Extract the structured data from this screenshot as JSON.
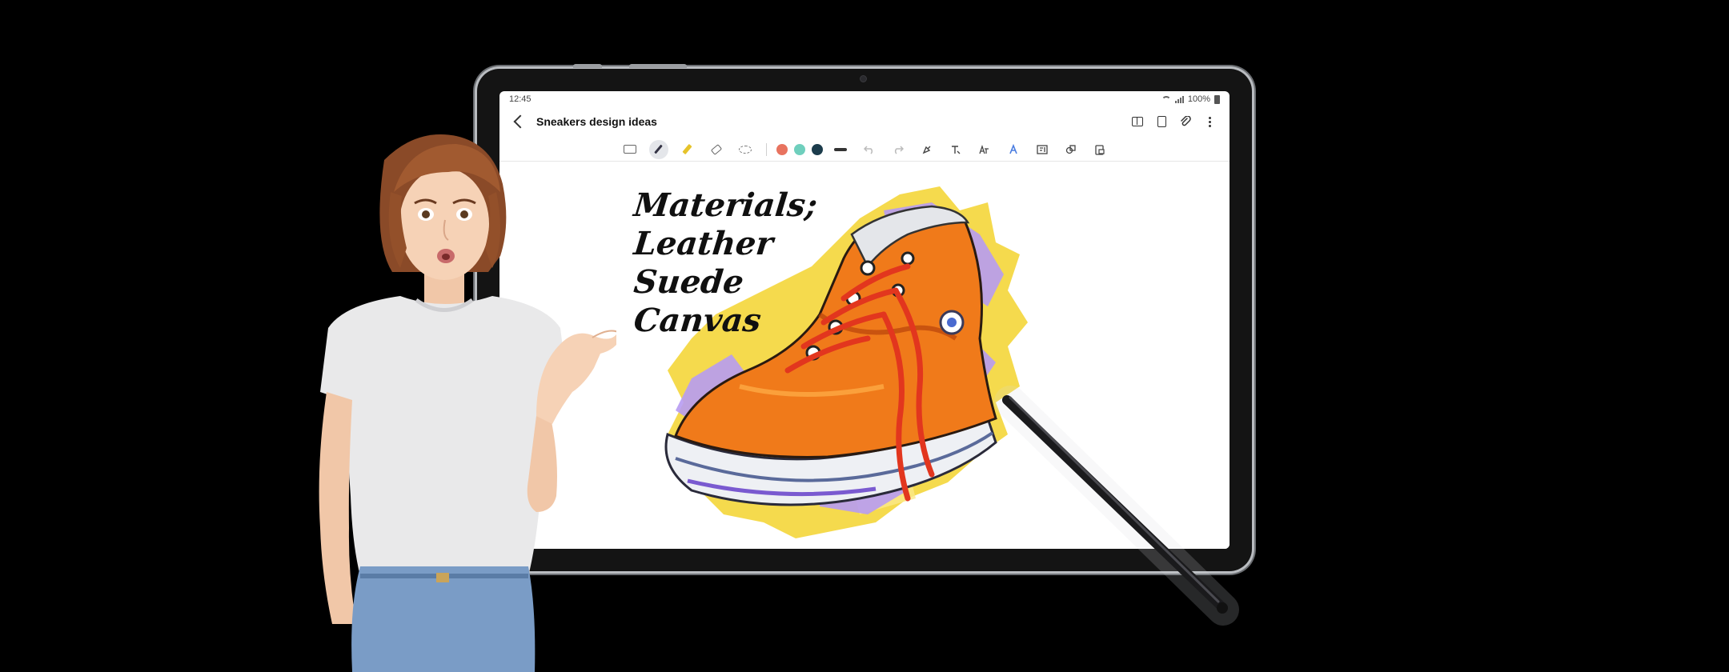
{
  "status_bar": {
    "time": "12:45",
    "battery": "100%"
  },
  "note": {
    "title": "Sneakers design ideas"
  },
  "toolbar": {
    "tools": [
      "keyboard-icon",
      "pen-icon",
      "highlighter-icon",
      "eraser-icon",
      "lasso-icon"
    ],
    "colors": [
      "#e8735f",
      "#6fcfbd",
      "#1c3c4c"
    ],
    "active_tool": "pen-icon"
  },
  "handwriting": {
    "lines": [
      "Materials;",
      "Leather",
      "Suede",
      "Canvas"
    ]
  },
  "colors": {
    "background": "#000000",
    "tablet_frame": "#b9bcc0",
    "screen": "#ffffff",
    "shoe_orange": "#f07a1a",
    "splash_yellow": "#f4d63a",
    "splash_purple": "#b79bf2"
  }
}
